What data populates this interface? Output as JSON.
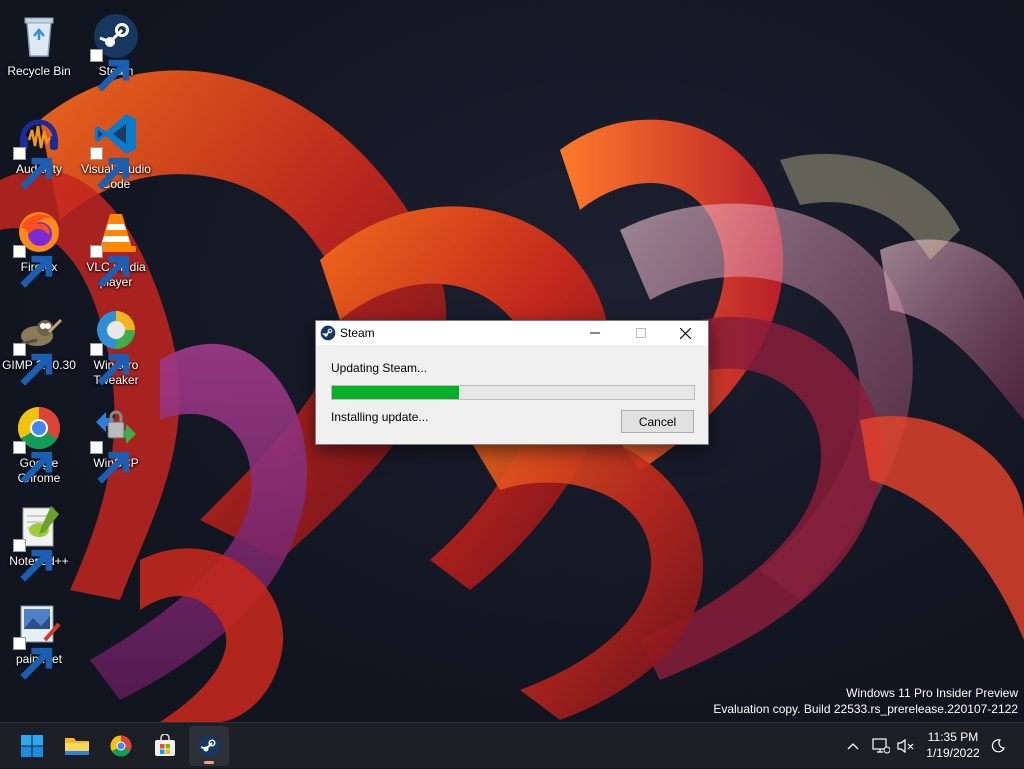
{
  "desktop": {
    "icons": [
      {
        "label": "Recycle Bin",
        "icon": "recycle-bin-icon"
      },
      {
        "label": "Steam",
        "icon": "steam-icon"
      },
      {
        "label": "Audacity",
        "icon": "audacity-icon"
      },
      {
        "label": "Visual Studio Code",
        "icon": "vscode-icon"
      },
      {
        "label": "Firefox",
        "icon": "firefox-icon"
      },
      {
        "label": "VLC media player",
        "icon": "vlc-icon"
      },
      {
        "label": "GIMP 2.10.30",
        "icon": "gimp-icon"
      },
      {
        "label": "Winaero Tweaker",
        "icon": "winaero-tweaker-icon"
      },
      {
        "label": "Google Chrome",
        "icon": "chrome-icon"
      },
      {
        "label": "WinSCP",
        "icon": "winscp-icon"
      },
      {
        "label": "Notepad++",
        "icon": "notepadpp-icon"
      },
      {
        "label": "paint.net",
        "icon": "paintnet-icon"
      }
    ]
  },
  "dialog": {
    "title": "Steam",
    "status": "Updating Steam...",
    "progress_fraction": 0.35,
    "detail": "Installing update...",
    "cancel_label": "Cancel",
    "progress_color": "#06b025"
  },
  "watermark": {
    "line1": "Windows 11 Pro Insider Preview",
    "line2": "Evaluation copy. Build 22533.rs_prerelease.220107-2122"
  },
  "taskbar": {
    "items": [
      "windows-start-icon",
      "file-explorer-icon",
      "chrome-icon",
      "microsoft-store-icon",
      "steam-icon"
    ],
    "active": "steam-icon",
    "tray_icons": [
      "chevron-up-icon",
      "network-icon",
      "volume-muted-icon",
      "focus-assist-icon"
    ],
    "time": "11:35 PM",
    "date": "1/19/2022"
  }
}
